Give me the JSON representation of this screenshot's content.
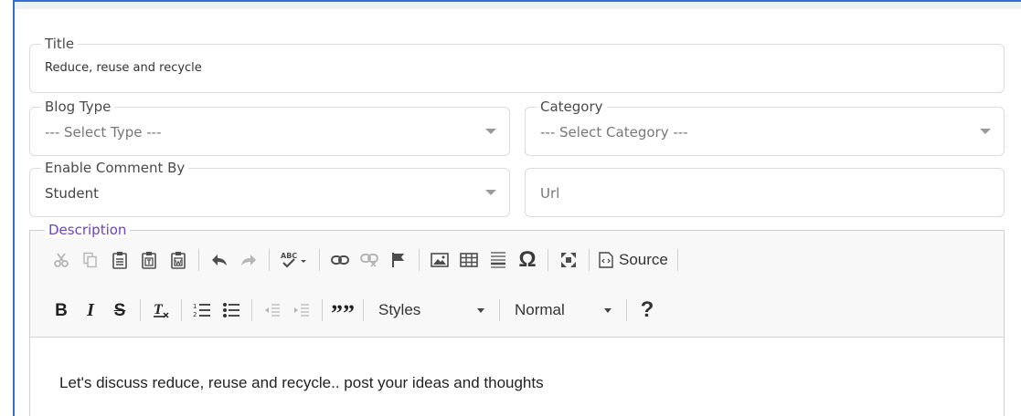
{
  "form": {
    "title": {
      "label": "Title",
      "value": "Reduce, reuse and recycle"
    },
    "blog_type": {
      "label": "Blog Type",
      "value": "--- Select Type ---"
    },
    "category": {
      "label": "Category",
      "value": "--- Select Category ---"
    },
    "enable_comment_by": {
      "label": "Enable Comment By",
      "value": "Student"
    },
    "url": {
      "placeholder": "Url"
    },
    "description": {
      "label": "Description"
    }
  },
  "editor": {
    "toolbar": {
      "source_label": "Source",
      "styles_label": "Styles",
      "format_label": "Normal",
      "help_label": "?",
      "bold_label": "B",
      "italic_label": "I",
      "strike_label": "S",
      "blockquote_label": "””",
      "special_char_label": "Ω"
    },
    "content": "Let's discuss reduce, reuse and recycle.. post your ideas and thoughts"
  },
  "colors": {
    "frame_border": "#2e6fd0",
    "description_label": "#6f42c1"
  }
}
